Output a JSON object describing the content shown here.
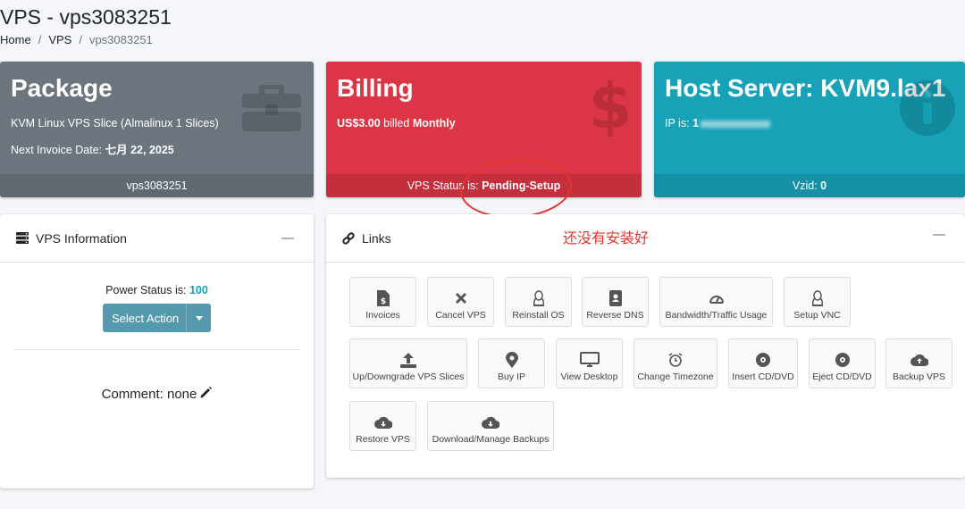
{
  "page": {
    "title": "VPS - vps3083251",
    "breadcrumb": [
      "Home",
      "VPS",
      "vps3083251"
    ]
  },
  "package_box": {
    "title": "Package",
    "description": "KVM Linux VPS Slice (Almalinux 1 Slices)",
    "next_invoice_label": "Next Invoice Date:",
    "next_invoice_value": "七月 22, 2025",
    "footer": "vps3083251",
    "icon": "toolbox-icon",
    "color": "#6c757d"
  },
  "billing_box": {
    "title": "Billing",
    "amount": "US$3.00",
    "billed_text": "billed",
    "period": "Monthly",
    "status_label": "VPS Status is:",
    "status_value": "Pending-Setup",
    "icon": "dollar-icon",
    "color": "#dc3545"
  },
  "host_box": {
    "title": "Host Server: KVM9.lax1",
    "ip_label": "IP is:",
    "ip_value": "1",
    "vzid_label": "Vzid:",
    "vzid_value": "0",
    "icon": "info-icon",
    "color": "#17a2b8"
  },
  "vps_info": {
    "title": "VPS Information",
    "power_label": "Power Status is:",
    "power_value": "100",
    "select_action": "Select Action",
    "comment": "Comment: none"
  },
  "links": {
    "title": "Links",
    "annotation": "还没有安装好",
    "items": [
      {
        "label": "Invoices",
        "icon": "invoice-icon"
      },
      {
        "label": "Cancel VPS",
        "icon": "close-icon"
      },
      {
        "label": "Reinstall OS",
        "icon": "linux-icon"
      },
      {
        "label": "Reverse DNS",
        "icon": "address-book-icon"
      },
      {
        "label": "Bandwidth/Traffic Usage",
        "icon": "gauge-icon"
      },
      {
        "label": "Setup VNC",
        "icon": "linux-icon"
      },
      {
        "label": "Up/Downgrade VPS Slices",
        "icon": "upload-icon"
      },
      {
        "label": "Buy IP",
        "icon": "map-marker-icon"
      },
      {
        "label": "View Desktop",
        "icon": "desktop-icon"
      },
      {
        "label": "Change Timezone",
        "icon": "alarm-clock-icon"
      },
      {
        "label": "Insert CD/DVD",
        "icon": "disc-icon"
      },
      {
        "label": "Eject CD/DVD",
        "icon": "disc-icon"
      },
      {
        "label": "Backup VPS",
        "icon": "cloud-upload-icon"
      },
      {
        "label": "Restore VPS",
        "icon": "cloud-download-icon"
      },
      {
        "label": "Download/Manage Backups",
        "icon": "cloud-download-icon"
      }
    ]
  }
}
